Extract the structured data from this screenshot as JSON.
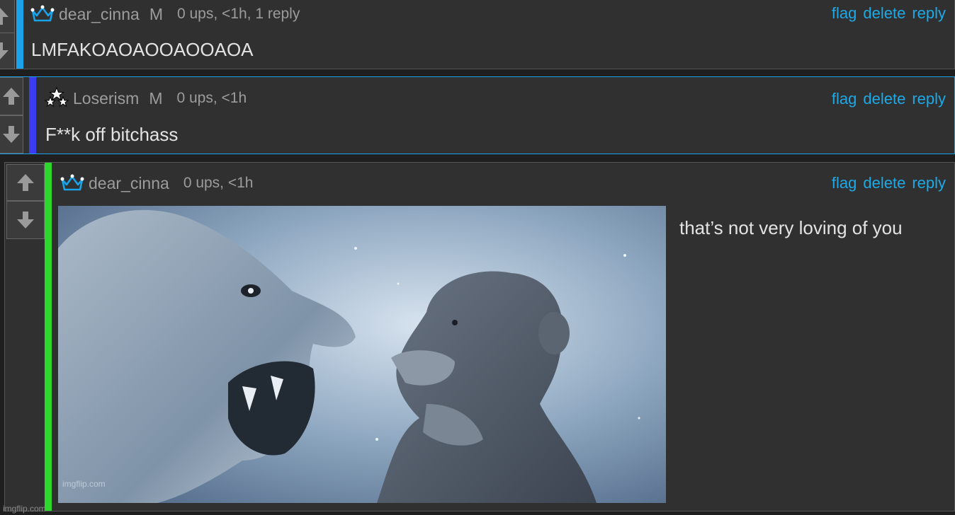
{
  "comments": [
    {
      "username": "dear_cinna",
      "mod_tag": "M",
      "meta": "0 ups, <1h, 1 reply",
      "body": "LMFAKOAOAOOAOOAOA",
      "bar_color": "#1aa3e8",
      "badge_icon": "crown-icon",
      "actions": {
        "flag": "flag",
        "delete": "delete",
        "reply": "reply"
      }
    },
    {
      "username": "Loserism",
      "mod_tag": "M",
      "meta": "0 ups, <1h",
      "body": "F**k off bitchass",
      "bar_color": "#3b3bf0",
      "badge_icon": "stars-icon",
      "actions": {
        "flag": "flag",
        "delete": "delete",
        "reply": "reply"
      }
    },
    {
      "username": "dear_cinna",
      "meta": "0 ups, <1h",
      "body": "that’s not very loving of you",
      "bar_color": "#2bd82b",
      "badge_icon": "crown-icon",
      "image_watermark": "imgflip.com",
      "actions": {
        "flag": "flag",
        "delete": "delete",
        "reply": "reply"
      }
    }
  ],
  "page_watermark": "imgflip.com",
  "accent_link_color": "#1ea9e6"
}
